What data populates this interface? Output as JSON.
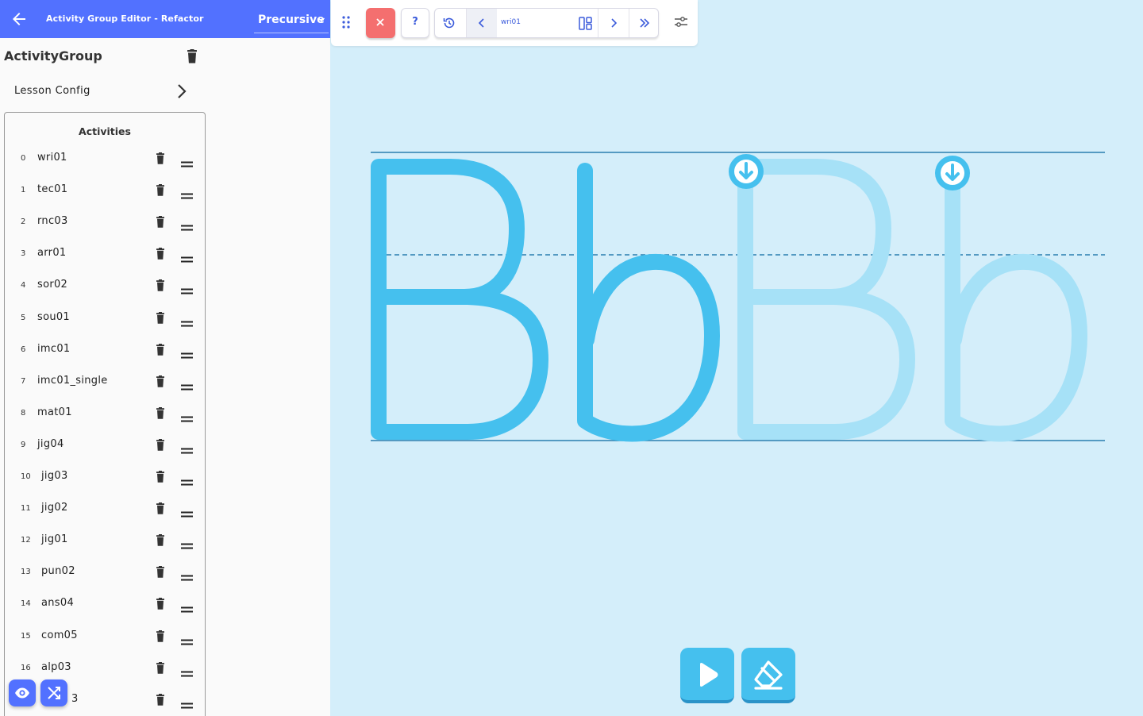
{
  "app": {
    "title": "Activity Group Editor - Refactor",
    "font_select": "Precursive",
    "accent": "#5271ff"
  },
  "group": {
    "title": "ActivityGroup",
    "lesson_config_label": "Lesson Config"
  },
  "activities": {
    "header": "Activities",
    "items": [
      {
        "index": "0",
        "name": "wri01"
      },
      {
        "index": "1",
        "name": "tec01"
      },
      {
        "index": "2",
        "name": "rnc03"
      },
      {
        "index": "3",
        "name": "arr01"
      },
      {
        "index": "4",
        "name": "sor02"
      },
      {
        "index": "5",
        "name": "sou01"
      },
      {
        "index": "6",
        "name": "imc01"
      },
      {
        "index": "7",
        "name": "imc01_single"
      },
      {
        "index": "8",
        "name": "mat01"
      },
      {
        "index": "9",
        "name": "jig04"
      },
      {
        "index": "10",
        "name": "jig03"
      },
      {
        "index": "11",
        "name": "jig02"
      },
      {
        "index": "12",
        "name": "jig01"
      },
      {
        "index": "13",
        "name": "pun02"
      },
      {
        "index": "14",
        "name": "ans04"
      },
      {
        "index": "15",
        "name": "com05"
      },
      {
        "index": "16",
        "name": "alp03"
      },
      {
        "index": "",
        "name": "3"
      }
    ]
  },
  "toolbar": {
    "help_label": "?",
    "current_activity": "wri01"
  },
  "canvas": {
    "letters": "BbBb",
    "background": "#d4eefa",
    "stroke_color": "#45c0ee",
    "trace_color": "#a6e1f7",
    "guide_color": "#2a7fb0"
  }
}
